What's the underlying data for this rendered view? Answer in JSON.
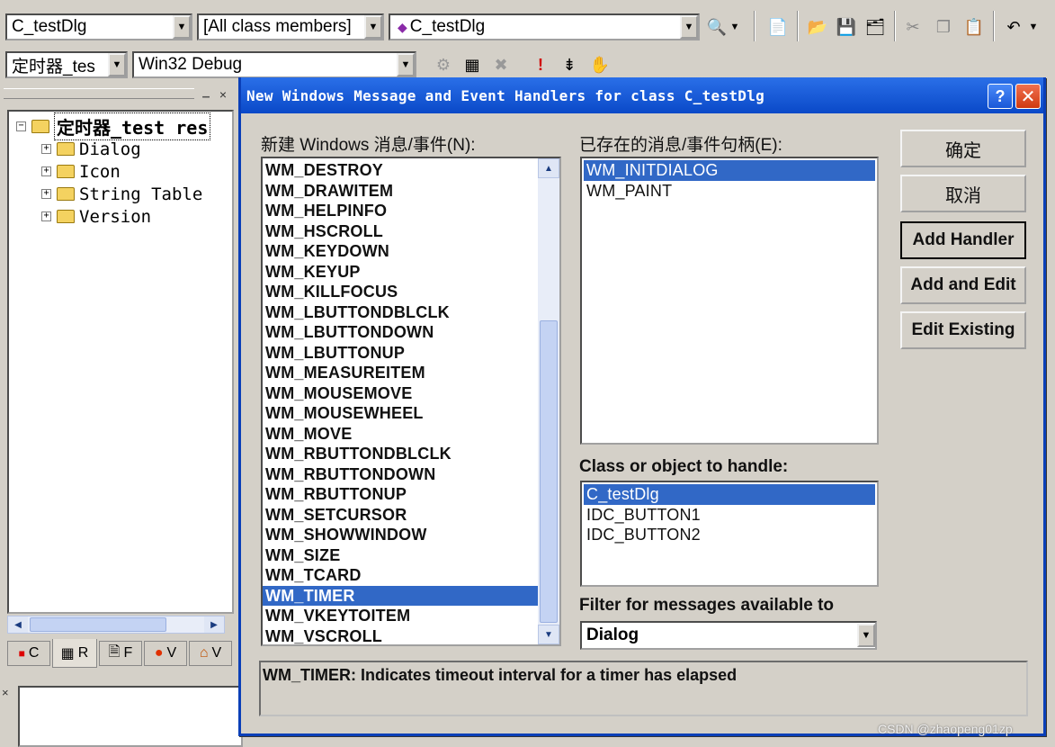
{
  "toolbar1": {
    "class_combo": "C_testDlg",
    "members_combo": "[All class members]",
    "function_combo": "C_testDlg"
  },
  "toolbar2": {
    "project_combo": "定时器_tes",
    "config_combo": "Win32 Debug"
  },
  "tree": {
    "root": "定时器_test res",
    "items": [
      "Dialog",
      "Icon",
      "String Table",
      "Version"
    ]
  },
  "workspace_tabs": [
    "C",
    "R",
    "F",
    "V",
    "V"
  ],
  "dialog": {
    "title": "New Windows Message and Event Handlers for class C_testDlg",
    "new_label": "新建 Windows 消息/事件(N):",
    "existing_label": "已存在的消息/事件句柄(E):",
    "messages": [
      "WM_DESTROY",
      "WM_DRAWITEM",
      "WM_HELPINFO",
      "WM_HSCROLL",
      "WM_KEYDOWN",
      "WM_KEYUP",
      "WM_KILLFOCUS",
      "WM_LBUTTONDBLCLK",
      "WM_LBUTTONDOWN",
      "WM_LBUTTONUP",
      "WM_MEASUREITEM",
      "WM_MOUSEMOVE",
      "WM_MOUSEWHEEL",
      "WM_MOVE",
      "WM_RBUTTONDBLCLK",
      "WM_RBUTTONDOWN",
      "WM_RBUTTONUP",
      "WM_SETCURSOR",
      "WM_SHOWWINDOW",
      "WM_SIZE",
      "WM_TCARD",
      "WM_TIMER",
      "WM_VKEYTOITEM",
      "WM_VSCROLL"
    ],
    "selected_message": "WM_TIMER",
    "existing_handlers": [
      "WM_INITDIALOG",
      "WM_PAINT"
    ],
    "selected_handler": "WM_INITDIALOG",
    "class_label": "Class or object to handle:",
    "class_objects": [
      "C_testDlg",
      "IDC_BUTTON1",
      "IDC_BUTTON2"
    ],
    "selected_object": "C_testDlg",
    "filter_label": "Filter for messages available to",
    "filter_value": "Dialog",
    "buttons": {
      "ok": "确定",
      "cancel": "取消",
      "add_handler": "Add Handler",
      "add_edit": "Add and Edit",
      "edit_existing": "Edit Existing"
    },
    "description": "WM_TIMER:  Indicates timeout interval for a timer has elapsed"
  },
  "watermark": "CSDN @zhaopeng01zp",
  "colors": {
    "selection": "#3168c6",
    "titlebar": "#0a49c8",
    "face": "#d4d0c8"
  }
}
